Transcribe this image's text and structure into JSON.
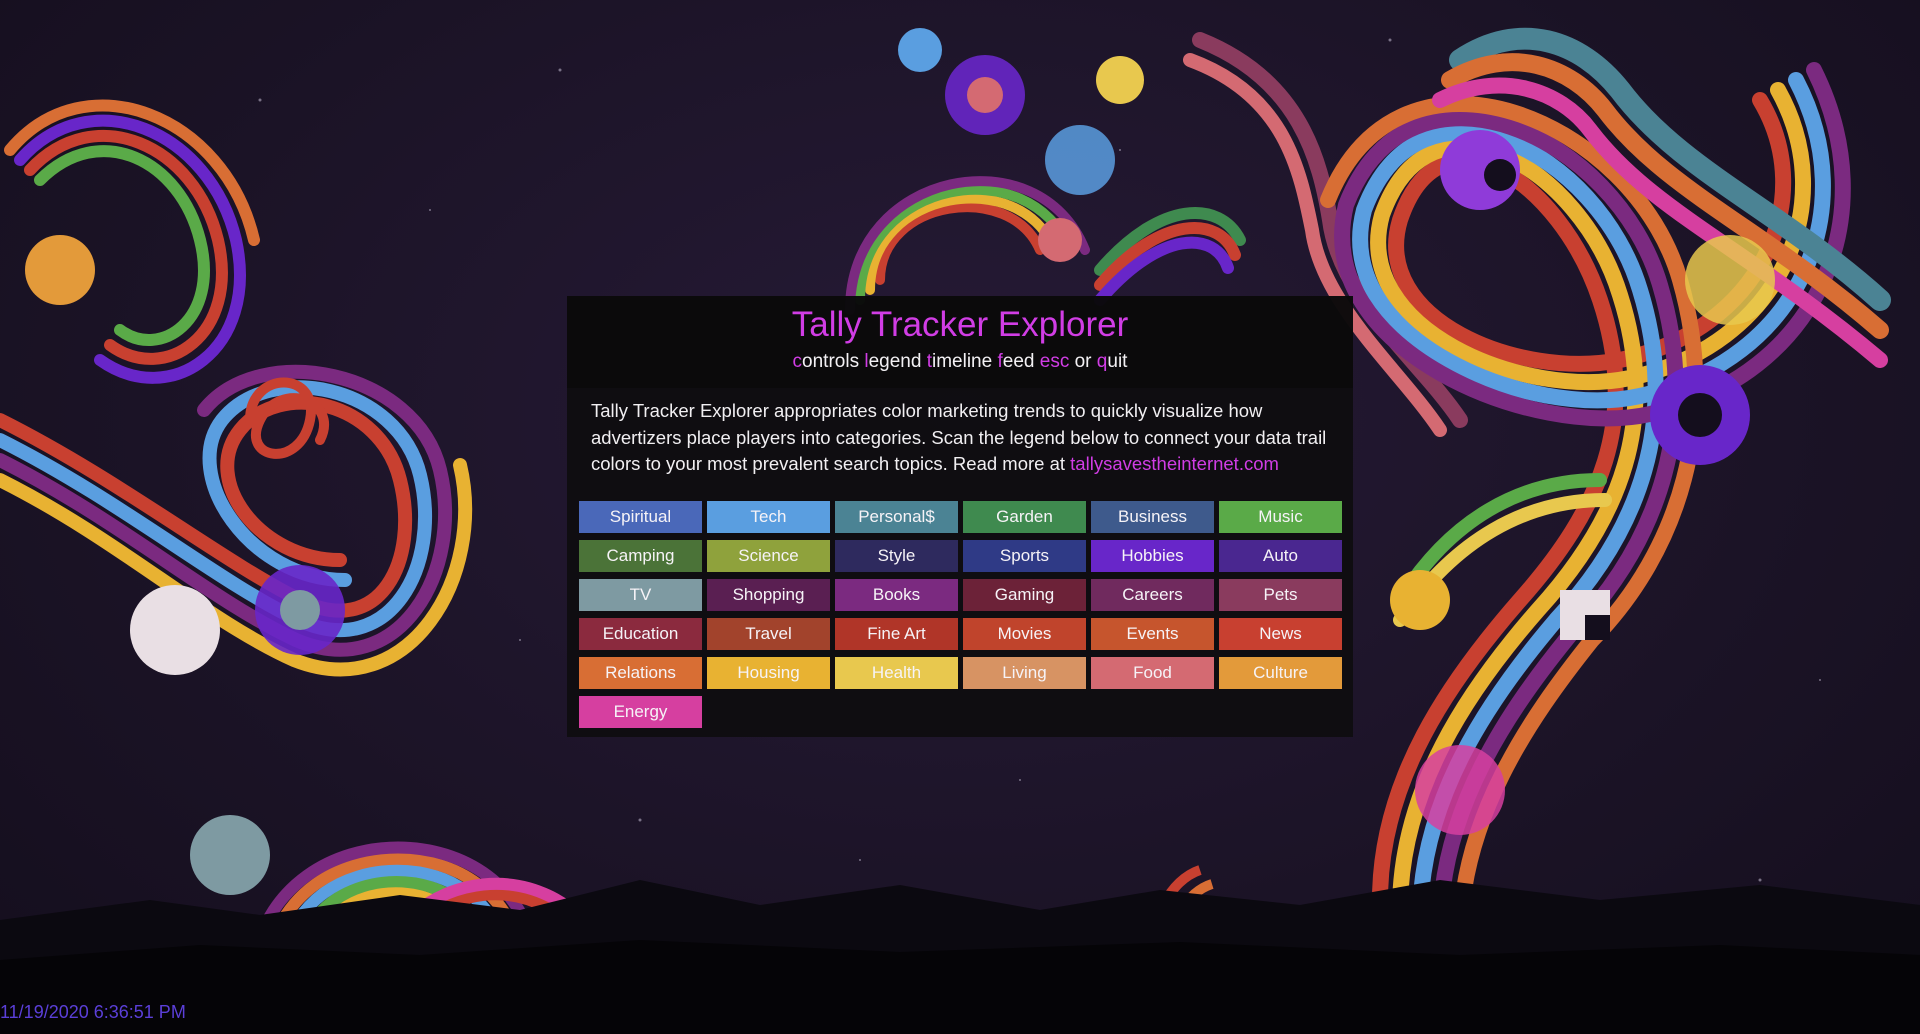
{
  "app": {
    "title": "Tally Tracker Explorer",
    "timestamp": "11/19/2020 6:36:51 PM"
  },
  "shortcuts": [
    {
      "key": "c",
      "rest": "ontrols"
    },
    {
      "key": "l",
      "rest": "egend"
    },
    {
      "key": "t",
      "rest": "imeline"
    },
    {
      "key": "f",
      "rest": "eed"
    },
    {
      "key": "esc",
      "rest": ""
    },
    {
      "key": "q",
      "rest": "uit"
    }
  ],
  "shortcut_joiner": "or",
  "description": {
    "text": "Tally Tracker Explorer appropriates color marketing trends to quickly visualize how advertizers place players into categories. Scan the legend below to connect your data trail colors to your most prevalent search topics. Read more at ",
    "link_text": "tallysavestheinternet.com"
  },
  "legend": [
    {
      "label": "Spiritual",
      "color": "#4a68b9"
    },
    {
      "label": "Tech",
      "color": "#5a9ee0"
    },
    {
      "label": "Personal$",
      "color": "#4b8394"
    },
    {
      "label": "Garden",
      "color": "#3f8a4f"
    },
    {
      "label": "Business",
      "color": "#3e5a8c"
    },
    {
      "label": "Music",
      "color": "#5aaa48"
    },
    {
      "label": "Camping",
      "color": "#4b7338"
    },
    {
      "label": "Science",
      "color": "#8fa23c"
    },
    {
      "label": "Style",
      "color": "#2e2a5e"
    },
    {
      "label": "Sports",
      "color": "#2f3a86"
    },
    {
      "label": "Hobbies",
      "color": "#6826c9"
    },
    {
      "label": "Auto",
      "color": "#4a2790"
    },
    {
      "label": "TV",
      "color": "#7e9aa2"
    },
    {
      "label": "Shopping",
      "color": "#5a1f52"
    },
    {
      "label": "Books",
      "color": "#7b2a80"
    },
    {
      "label": "Gaming",
      "color": "#6c2238"
    },
    {
      "label": "Careers",
      "color": "#702a5e"
    },
    {
      "label": "Pets",
      "color": "#8a3b5e"
    },
    {
      "label": "Education",
      "color": "#8b2a3e"
    },
    {
      "label": "Travel",
      "color": "#a2432c"
    },
    {
      "label": "Fine Art",
      "color": "#b03528"
    },
    {
      "label": "Movies",
      "color": "#c0442c"
    },
    {
      "label": "Events",
      "color": "#c6552d"
    },
    {
      "label": "News",
      "color": "#c84030"
    },
    {
      "label": "Relations",
      "color": "#d86e34"
    },
    {
      "label": "Housing",
      "color": "#e8b232"
    },
    {
      "label": "Health",
      "color": "#e8c84e"
    },
    {
      "label": "Living",
      "color": "#d79363"
    },
    {
      "label": "Food",
      "color": "#d46a72"
    },
    {
      "label": "Culture",
      "color": "#e39a3a"
    },
    {
      "label": "Energy",
      "color": "#d63fa0"
    }
  ],
  "colors": {
    "accent": "#d13de5",
    "panel": "#0e0d0f",
    "timestamp": "#5b3fd8"
  }
}
